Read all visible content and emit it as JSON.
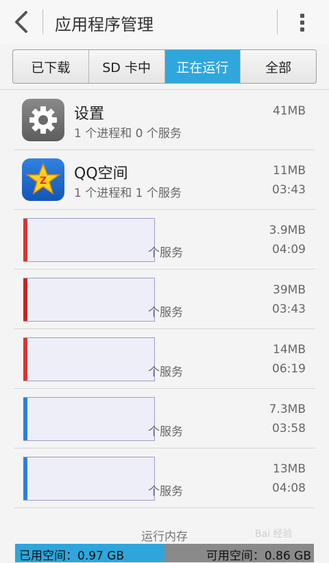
{
  "header": {
    "title": "应用程序管理",
    "back_icon": "chevron-left-icon",
    "menu_icon": "overflow-menu-icon"
  },
  "tabs": [
    {
      "label": "已下载",
      "active": false
    },
    {
      "label": "SD 卡中",
      "active": false
    },
    {
      "label": "正在运行",
      "active": true
    },
    {
      "label": "全部",
      "active": false
    }
  ],
  "accent_color": "#2fa7dc",
  "apps": [
    {
      "name": "设置",
      "subtitle": "1 个进程和 0 个服务",
      "size": "41MB",
      "time": "",
      "icon": "settings-gear-icon"
    },
    {
      "name": "QQ空间",
      "subtitle": "1 个进程和 1 个服务",
      "size": "11MB",
      "time": "03:43",
      "icon": "qq-zone-star-icon"
    },
    {
      "name": "",
      "subtitle": "个服务",
      "size": "3.9MB",
      "time": "04:09",
      "icon": "redacted-icon"
    },
    {
      "name": "",
      "subtitle": "个服务",
      "size": "39MB",
      "time": "03:43",
      "icon": "redacted-icon"
    },
    {
      "name": "",
      "subtitle": "个服务",
      "size": "14MB",
      "time": "06:19",
      "icon": "redacted-icon"
    },
    {
      "name": "",
      "subtitle": "个服务",
      "size": "7.3MB",
      "time": "03:58",
      "icon": "redacted-icon"
    },
    {
      "name": "",
      "subtitle": "个服务",
      "size": "13MB",
      "time": "04:08",
      "icon": "redacted-icon"
    }
  ],
  "memory": {
    "label": "运行内存",
    "used": "已用空间：0.97 GB",
    "free": "可用空间：0.86 GB",
    "used_fraction": 0.5
  },
  "watermark": "Bai 经验"
}
